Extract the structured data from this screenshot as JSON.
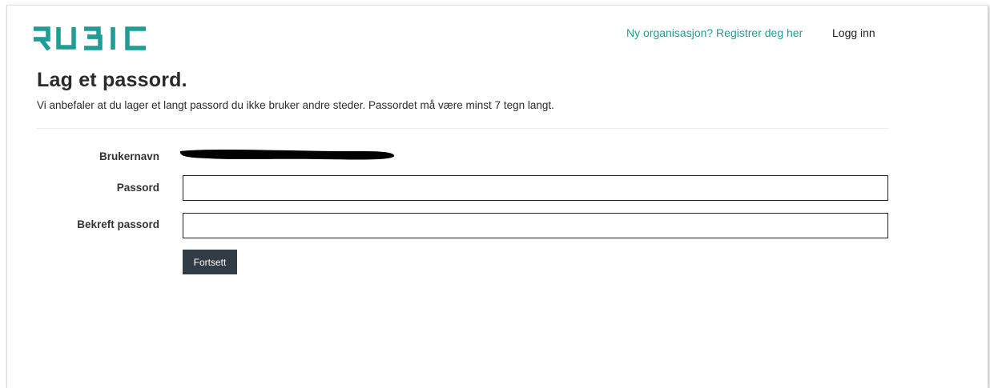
{
  "brand": {
    "name": "RUBIC",
    "color": "#1f9c96"
  },
  "header": {
    "register_link": "Ny organisasjon? Registrer deg her",
    "login_link": "Logg inn"
  },
  "main": {
    "title": "Lag et passord.",
    "intro": "Vi anbefaler at du lager et langt passord du ikke bruker andre steder. Passordet må være minst 7 tegn langt."
  },
  "form": {
    "username_label": "Brukernavn",
    "password_label": "Passord",
    "confirm_label": "Bekreft passord",
    "password_value": "",
    "confirm_value": "",
    "submit_label": "Fortsett",
    "submit_color": "#323c45"
  }
}
